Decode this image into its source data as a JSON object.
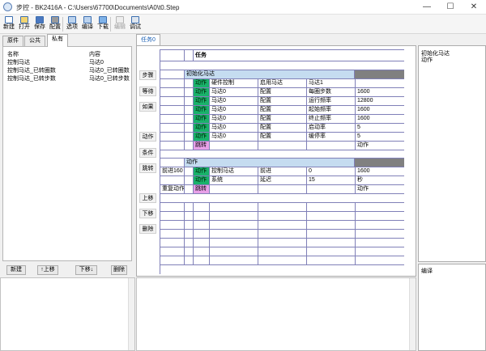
{
  "window": {
    "app_icon": "stepper-app-icon",
    "title": "步控 - BK2416A - C:\\Users\\67700\\Documents\\A0\\t0.Step",
    "minimize": "—",
    "maximize": "☐",
    "close": "✕"
  },
  "toolbar": {
    "items": [
      {
        "label": "新建",
        "icon": "new-file-icon",
        "color": "#ffffff"
      },
      {
        "label": "打开",
        "icon": "open-folder-icon",
        "color": "#f3d470"
      },
      {
        "label": "保存",
        "icon": "save-disk-icon",
        "color": "#4a78c0"
      },
      {
        "label": "配置",
        "icon": "wrench-icon",
        "color": "#9a9a9a"
      },
      {
        "label": "选项",
        "icon": "options-icon",
        "color": "#bcd3ee"
      },
      {
        "label": "编译",
        "icon": "compile-icon",
        "color": "#bcd3ee"
      },
      {
        "label": "下载",
        "icon": "download-icon",
        "color": "#7fb2e8"
      },
      {
        "label": "编辑",
        "icon": "edit-icon",
        "color": "#eeeeee",
        "disabled": true
      },
      {
        "label": "调试",
        "icon": "debug-icon",
        "color": "#dfe6ef"
      }
    ]
  },
  "left": {
    "tabs": [
      "原件",
      "公共",
      "私有"
    ],
    "header": {
      "name": "名称",
      "content": "内容"
    },
    "rows": [
      {
        "name": "控制马达",
        "content": "马达0"
      },
      {
        "name": "控制马达_已转圈数",
        "content": "马达0_已转圈数"
      },
      {
        "name": "控制马达_已转步数",
        "content": "马达0_已转步数"
      }
    ],
    "buttons": [
      "新建",
      "↑上移",
      "下移↓",
      "删除"
    ]
  },
  "main": {
    "tab": "任务0",
    "side_buttons": [
      "步骤",
      "等待",
      "如果",
      "动作",
      "条件",
      "跳转",
      "上移",
      "下移",
      "删除"
    ],
    "title": "任务",
    "group1": {
      "header": "初始化马达",
      "rows": [
        {
          "tag": "动作",
          "c1": "硬件控制",
          "c2": "启用马达",
          "c3": "马达1",
          "c4": ""
        },
        {
          "tag": "动作",
          "c1": "马达0",
          "c2": "配置",
          "c3": "每圈步数",
          "c4": "1600"
        },
        {
          "tag": "动作",
          "c1": "马达0",
          "c2": "配置",
          "c3": "运行频率",
          "c4": "12800"
        },
        {
          "tag": "动作",
          "c1": "马达0",
          "c2": "配置",
          "c3": "起始频率",
          "c4": "1600"
        },
        {
          "tag": "动作",
          "c1": "马达0",
          "c2": "配置",
          "c3": "终止频率",
          "c4": "1600"
        },
        {
          "tag": "动作",
          "c1": "马达0",
          "c2": "配置",
          "c3": "启动率",
          "c4": "5"
        },
        {
          "tag": "动作",
          "c1": "马达0",
          "c2": "配置",
          "c3": "缓停率",
          "c4": "5"
        }
      ],
      "jump": {
        "tag": "跳转",
        "target": "动作"
      }
    },
    "group2": {
      "header": "动作",
      "rows": [
        {
          "label": "前进160",
          "tag": "动作",
          "c1": "控制马达",
          "c2": "前进",
          "c3": "0",
          "c4": "1600"
        },
        {
          "label": "",
          "tag": "动作",
          "c1": "系统",
          "c2": "延迟",
          "c3": "15",
          "c4": "秒"
        }
      ],
      "jump": {
        "label": "重复动作",
        "tag": "跳转",
        "target": "动作"
      }
    }
  },
  "right": {
    "lines": [
      "初始化马达",
      "动作"
    ],
    "bottom_label": "编译"
  }
}
